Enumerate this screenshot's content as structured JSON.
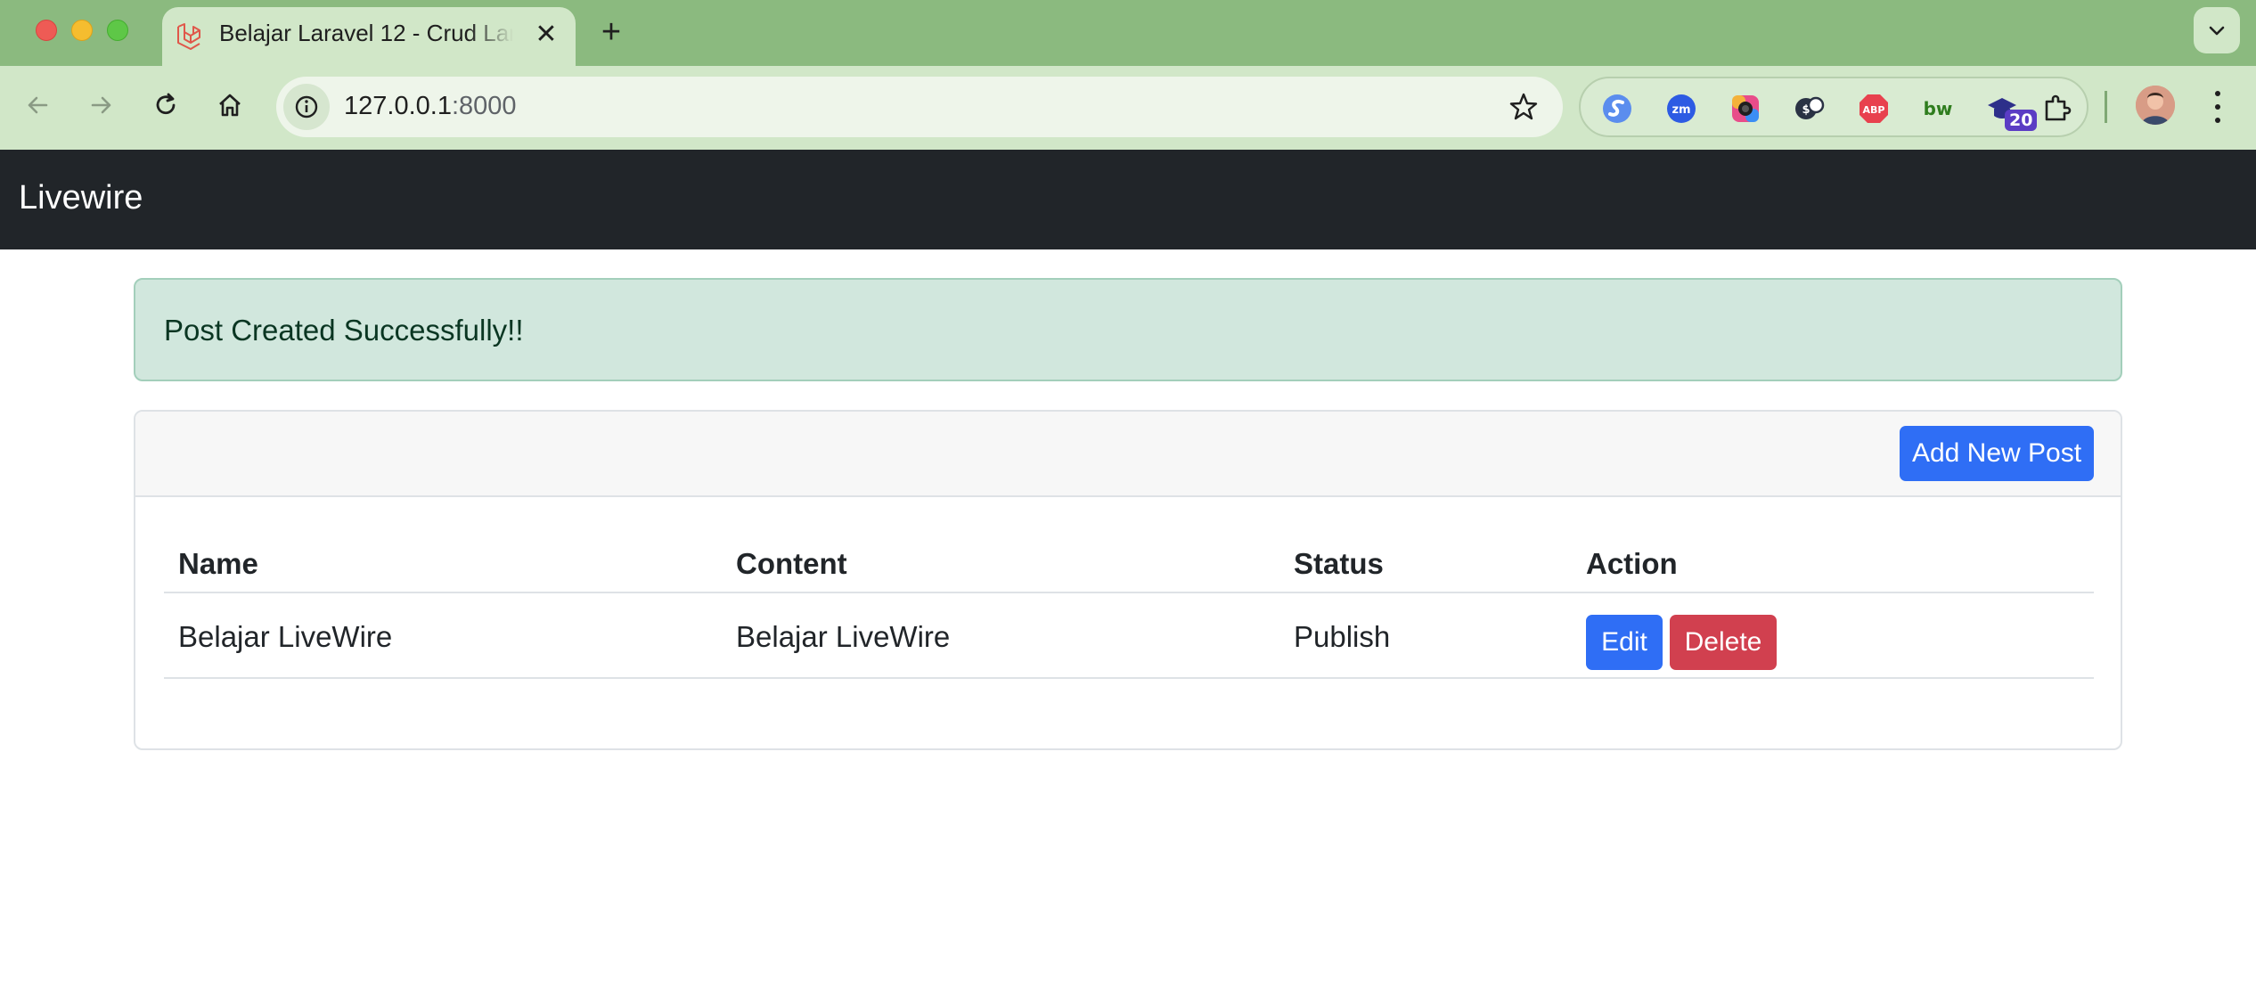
{
  "browser": {
    "tab_title": "Belajar Laravel 12 - Crud Laravel 12",
    "tab_close": "✕",
    "new_tab": "+",
    "url_host": "127.0.0.1",
    "url_port": ":8000",
    "extension_badge": "20"
  },
  "navbar": {
    "brand": "Livewire"
  },
  "alert": {
    "message": "Post Created Successfully!!"
  },
  "card": {
    "add_button": "Add New Post",
    "table": {
      "headers": [
        "Name",
        "Content",
        "Status",
        "Action"
      ],
      "rows": [
        {
          "name": "Belajar LiveWire",
          "content": "Belajar LiveWire",
          "status": "Publish",
          "edit": "Edit",
          "delete": "Delete"
        }
      ]
    }
  },
  "colors": {
    "chrome_tabbar": "#8bba7f",
    "chrome_toolbar": "#d1e7c8",
    "navbar": "#212529",
    "alert_bg": "#d1e7dd",
    "primary": "#2f6ef5",
    "danger": "#d1404f"
  }
}
